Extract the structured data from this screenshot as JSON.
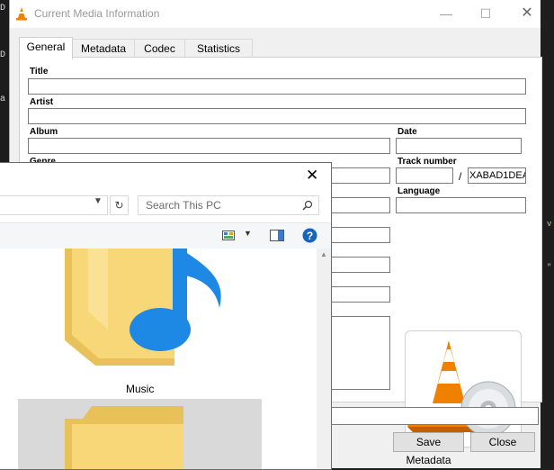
{
  "background": {
    "left_glyphs": [
      "D",
      "D",
      "a"
    ],
    "right_glyphs": [
      "v",
      "\""
    ]
  },
  "vlc": {
    "title": "Current Media Information",
    "tabs": [
      {
        "label": "General",
        "active": true
      },
      {
        "label": "Metadata",
        "active": false
      },
      {
        "label": "Codec",
        "active": false
      },
      {
        "label": "Statistics",
        "active": false
      }
    ],
    "labels": {
      "title": "Title",
      "artist": "Artist",
      "album": "Album",
      "date": "Date",
      "genre": "Genre",
      "track_number": "Track number",
      "language": "Language"
    },
    "values": {
      "title": "",
      "artist": "",
      "album": "",
      "date": "",
      "genre": "",
      "track": "",
      "track_separator": "/",
      "track_total": "XABAD1DEA",
      "language": ""
    },
    "buttons": {
      "save": "Save Metadata",
      "close": "Close"
    }
  },
  "explorer": {
    "search_placeholder": "Search This PC",
    "folders": [
      {
        "label": "Music"
      }
    ]
  },
  "colors": {
    "dialog_bg": "#f0f0f0",
    "vlc_orange": "#f08000",
    "music_blue": "#1e88e5",
    "folder_yellow": "#f7d777",
    "selected_tile": "#d9d9d9"
  }
}
